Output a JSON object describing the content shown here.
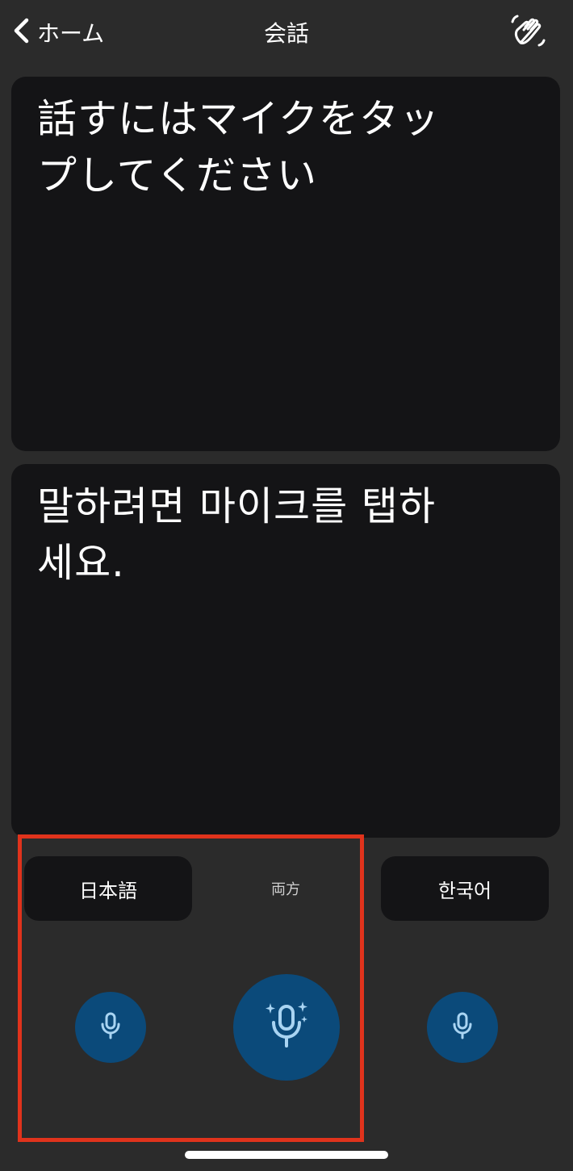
{
  "header": {
    "back_label": "ホーム",
    "title": "会話"
  },
  "panels": {
    "japanese_prompt": "話すにはマイクをタップしてください",
    "korean_prompt": "말하려면 마이크를 탭하세요."
  },
  "controls": {
    "japanese_label": "日本語",
    "both_label": "両方",
    "korean_label": "한국어"
  },
  "icons": {
    "back": "chevron-left-icon",
    "wave": "waving-hand-icon",
    "mic": "microphone-icon",
    "mic_both": "microphone-sparkle-icon"
  },
  "colors": {
    "background": "#2b2b2b",
    "panel": "#141416",
    "mic_button": "#0b4a7a",
    "mic_icon": "#a9d4f2",
    "highlight": "#e0331c"
  }
}
